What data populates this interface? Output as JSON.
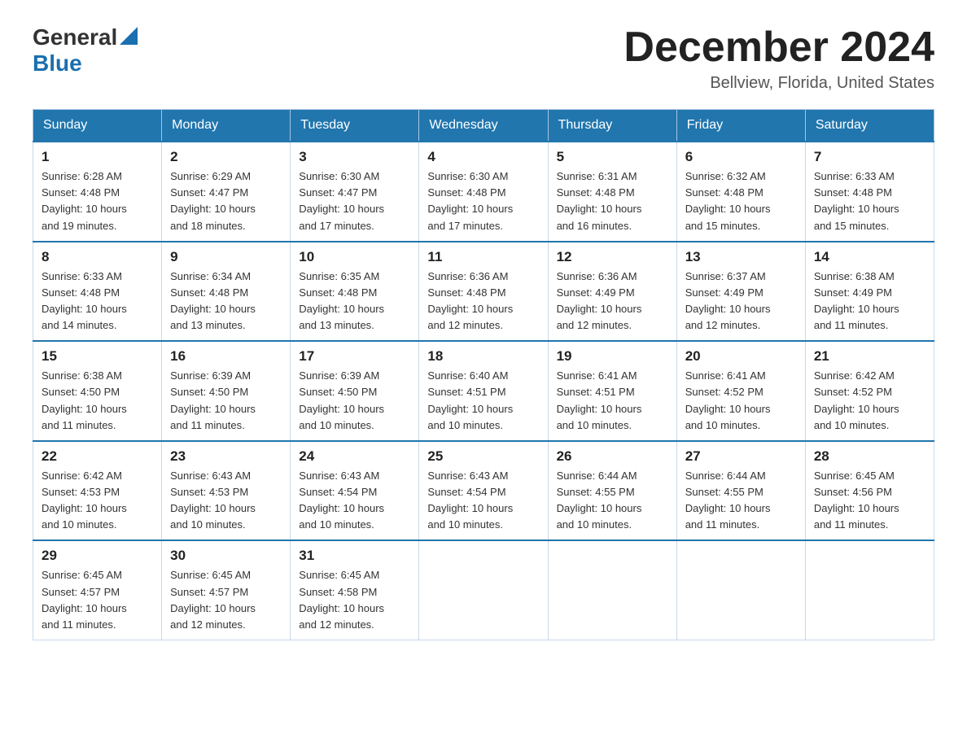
{
  "header": {
    "logo_general": "General",
    "logo_blue": "Blue",
    "month_title": "December 2024",
    "location": "Bellview, Florida, United States"
  },
  "calendar": {
    "days_of_week": [
      "Sunday",
      "Monday",
      "Tuesday",
      "Wednesday",
      "Thursday",
      "Friday",
      "Saturday"
    ],
    "weeks": [
      [
        {
          "day": "1",
          "sunrise": "6:28 AM",
          "sunset": "4:48 PM",
          "daylight": "10 hours and 19 minutes."
        },
        {
          "day": "2",
          "sunrise": "6:29 AM",
          "sunset": "4:47 PM",
          "daylight": "10 hours and 18 minutes."
        },
        {
          "day": "3",
          "sunrise": "6:30 AM",
          "sunset": "4:47 PM",
          "daylight": "10 hours and 17 minutes."
        },
        {
          "day": "4",
          "sunrise": "6:30 AM",
          "sunset": "4:48 PM",
          "daylight": "10 hours and 17 minutes."
        },
        {
          "day": "5",
          "sunrise": "6:31 AM",
          "sunset": "4:48 PM",
          "daylight": "10 hours and 16 minutes."
        },
        {
          "day": "6",
          "sunrise": "6:32 AM",
          "sunset": "4:48 PM",
          "daylight": "10 hours and 15 minutes."
        },
        {
          "day": "7",
          "sunrise": "6:33 AM",
          "sunset": "4:48 PM",
          "daylight": "10 hours and 15 minutes."
        }
      ],
      [
        {
          "day": "8",
          "sunrise": "6:33 AM",
          "sunset": "4:48 PM",
          "daylight": "10 hours and 14 minutes."
        },
        {
          "day": "9",
          "sunrise": "6:34 AM",
          "sunset": "4:48 PM",
          "daylight": "10 hours and 13 minutes."
        },
        {
          "day": "10",
          "sunrise": "6:35 AM",
          "sunset": "4:48 PM",
          "daylight": "10 hours and 13 minutes."
        },
        {
          "day": "11",
          "sunrise": "6:36 AM",
          "sunset": "4:48 PM",
          "daylight": "10 hours and 12 minutes."
        },
        {
          "day": "12",
          "sunrise": "6:36 AM",
          "sunset": "4:49 PM",
          "daylight": "10 hours and 12 minutes."
        },
        {
          "day": "13",
          "sunrise": "6:37 AM",
          "sunset": "4:49 PM",
          "daylight": "10 hours and 12 minutes."
        },
        {
          "day": "14",
          "sunrise": "6:38 AM",
          "sunset": "4:49 PM",
          "daylight": "10 hours and 11 minutes."
        }
      ],
      [
        {
          "day": "15",
          "sunrise": "6:38 AM",
          "sunset": "4:50 PM",
          "daylight": "10 hours and 11 minutes."
        },
        {
          "day": "16",
          "sunrise": "6:39 AM",
          "sunset": "4:50 PM",
          "daylight": "10 hours and 11 minutes."
        },
        {
          "day": "17",
          "sunrise": "6:39 AM",
          "sunset": "4:50 PM",
          "daylight": "10 hours and 10 minutes."
        },
        {
          "day": "18",
          "sunrise": "6:40 AM",
          "sunset": "4:51 PM",
          "daylight": "10 hours and 10 minutes."
        },
        {
          "day": "19",
          "sunrise": "6:41 AM",
          "sunset": "4:51 PM",
          "daylight": "10 hours and 10 minutes."
        },
        {
          "day": "20",
          "sunrise": "6:41 AM",
          "sunset": "4:52 PM",
          "daylight": "10 hours and 10 minutes."
        },
        {
          "day": "21",
          "sunrise": "6:42 AM",
          "sunset": "4:52 PM",
          "daylight": "10 hours and 10 minutes."
        }
      ],
      [
        {
          "day": "22",
          "sunrise": "6:42 AM",
          "sunset": "4:53 PM",
          "daylight": "10 hours and 10 minutes."
        },
        {
          "day": "23",
          "sunrise": "6:43 AM",
          "sunset": "4:53 PM",
          "daylight": "10 hours and 10 minutes."
        },
        {
          "day": "24",
          "sunrise": "6:43 AM",
          "sunset": "4:54 PM",
          "daylight": "10 hours and 10 minutes."
        },
        {
          "day": "25",
          "sunrise": "6:43 AM",
          "sunset": "4:54 PM",
          "daylight": "10 hours and 10 minutes."
        },
        {
          "day": "26",
          "sunrise": "6:44 AM",
          "sunset": "4:55 PM",
          "daylight": "10 hours and 10 minutes."
        },
        {
          "day": "27",
          "sunrise": "6:44 AM",
          "sunset": "4:55 PM",
          "daylight": "10 hours and 11 minutes."
        },
        {
          "day": "28",
          "sunrise": "6:45 AM",
          "sunset": "4:56 PM",
          "daylight": "10 hours and 11 minutes."
        }
      ],
      [
        {
          "day": "29",
          "sunrise": "6:45 AM",
          "sunset": "4:57 PM",
          "daylight": "10 hours and 11 minutes."
        },
        {
          "day": "30",
          "sunrise": "6:45 AM",
          "sunset": "4:57 PM",
          "daylight": "10 hours and 12 minutes."
        },
        {
          "day": "31",
          "sunrise": "6:45 AM",
          "sunset": "4:58 PM",
          "daylight": "10 hours and 12 minutes."
        },
        null,
        null,
        null,
        null
      ]
    ],
    "labels": {
      "sunrise": "Sunrise:",
      "sunset": "Sunset:",
      "daylight": "Daylight:"
    }
  }
}
